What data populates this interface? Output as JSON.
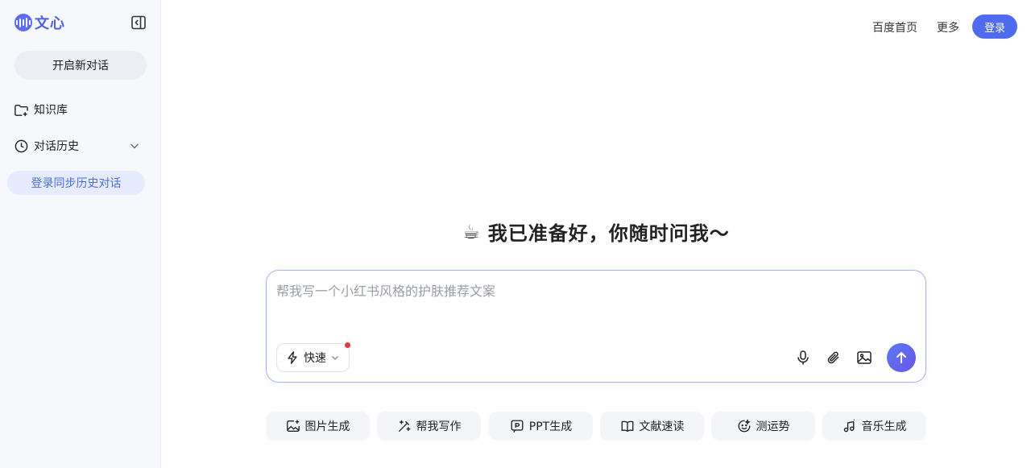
{
  "sidebar": {
    "logo_text": "文心",
    "new_chat_label": "开启新对话",
    "knowledge_label": "知识库",
    "history_label": "对话历史",
    "login_sync_label": "登录同步历史对话"
  },
  "header": {
    "baidu_home": "百度首页",
    "more": "更多",
    "login": "登录"
  },
  "hero": {
    "emoji": "☕",
    "title": "我已准备好，你随时问我～"
  },
  "input": {
    "placeholder": "帮我写一个小红书风格的护肤推荐文案",
    "mode_label": "快速"
  },
  "quick_actions": [
    {
      "label": "图片生成",
      "icon": "image-gen-icon"
    },
    {
      "label": "帮我写作",
      "icon": "magic-pen-icon"
    },
    {
      "label": "PPT生成",
      "icon": "ppt-icon"
    },
    {
      "label": "文献速读",
      "icon": "book-icon"
    },
    {
      "label": "测运势",
      "icon": "fortune-icon"
    },
    {
      "label": "音乐生成",
      "icon": "music-icon"
    }
  ],
  "colors": {
    "brand": "#4f6bf0",
    "sidebar_bg": "#f7f8fc",
    "badge_red": "#e9343a"
  }
}
